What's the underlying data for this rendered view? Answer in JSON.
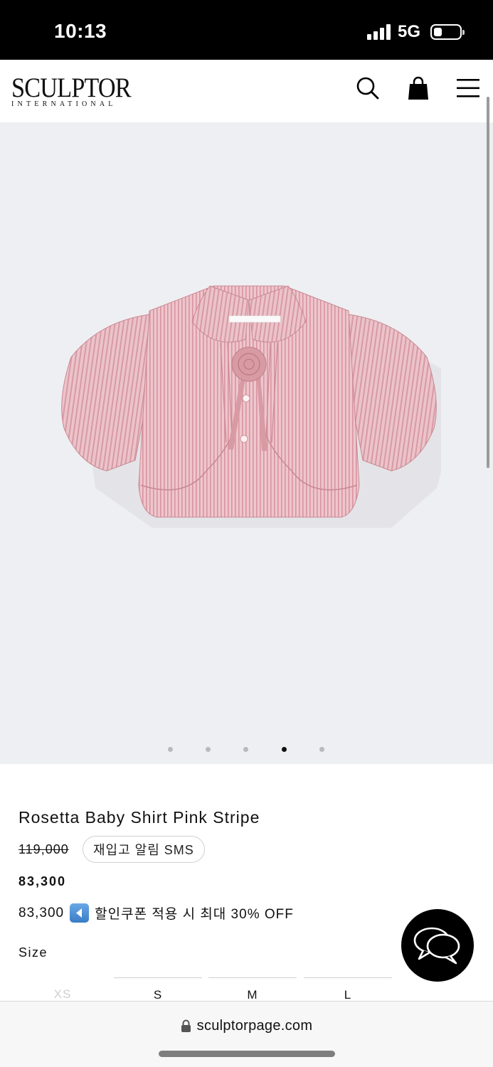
{
  "status_bar": {
    "time": "10:13",
    "network": "5G",
    "battery_level": 0.3
  },
  "header": {
    "logo_main": "SCULPTOR",
    "logo_sub": "INTERNATIONAL",
    "icons": [
      "search-icon",
      "shopping-bag-icon",
      "menu-icon"
    ]
  },
  "gallery": {
    "image_count": 5,
    "active_index": 4
  },
  "product": {
    "name": "Rosetta Baby Shirt Pink Stripe",
    "original_price": "119,000",
    "sms_button_label": "재입고 알림 SMS",
    "sale_price": "83,300",
    "coupon_price": "83,300",
    "coupon_text": "할인쿠폰 적용 시 최대 30% OFF",
    "size_label": "Size",
    "sizes": [
      {
        "label": "XS",
        "available": false
      },
      {
        "label": "S",
        "available": true
      },
      {
        "label": "M",
        "available": true
      },
      {
        "label": "L",
        "available": true
      }
    ]
  },
  "chat": {
    "icon": "chat-bubbles-icon"
  },
  "browser": {
    "url": "sculptorpage.com"
  },
  "colors": {
    "accent": "#000000",
    "gallery_bg": "#eeeff2",
    "shirt_pink": "#e8b8c0",
    "muted": "#cfcfcf"
  }
}
